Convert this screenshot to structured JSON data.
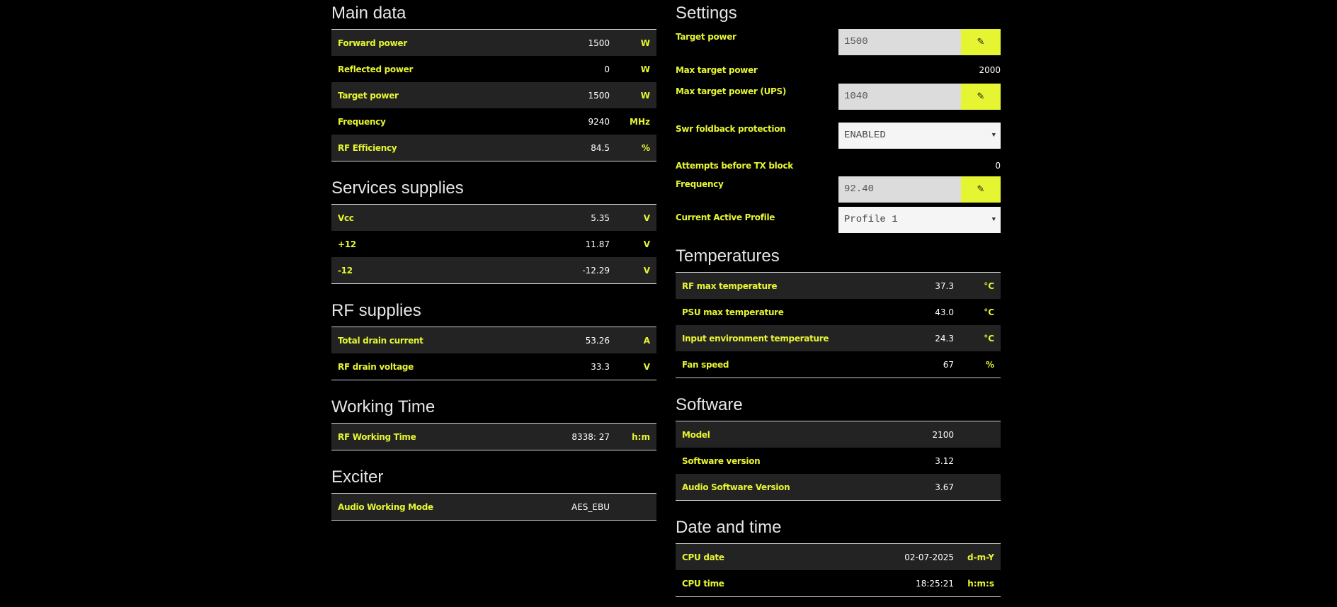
{
  "colors": {
    "accent": "#e6f532",
    "background": "#000000",
    "row_alt": "#232323"
  },
  "main_data": {
    "title": "Main data",
    "rows": [
      {
        "label": "Forward power",
        "value": "1500",
        "unit": "W"
      },
      {
        "label": "Reflected power",
        "value": "0",
        "unit": "W"
      },
      {
        "label": "Target power",
        "value": "1500",
        "unit": "W"
      },
      {
        "label": "Frequency",
        "value": "9240",
        "unit": "MHz"
      },
      {
        "label": "RF Efficiency",
        "value": "84.5",
        "unit": "%"
      }
    ]
  },
  "services_supplies": {
    "title": "Services supplies",
    "rows": [
      {
        "label": "Vcc",
        "value": "5.35",
        "unit": "V"
      },
      {
        "label": "+12",
        "value": "11.87",
        "unit": "V"
      },
      {
        "label": "-12",
        "value": "-12.29",
        "unit": "V"
      }
    ]
  },
  "rf_supplies": {
    "title": "RF supplies",
    "rows": [
      {
        "label": "Total drain current",
        "value": "53.26",
        "unit": "A"
      },
      {
        "label": "RF drain voltage",
        "value": "33.3",
        "unit": "V"
      }
    ]
  },
  "working_time": {
    "title": "Working Time",
    "rows": [
      {
        "label": "RF Working Time",
        "value": "8338: 27",
        "unit": "h:m"
      }
    ]
  },
  "exciter": {
    "title": "Exciter",
    "rows": [
      {
        "label": "Audio Working Mode",
        "value": "AES_EBU",
        "unit": ""
      }
    ]
  },
  "settings": {
    "title": "Settings",
    "target_power": {
      "label": "Target power",
      "value": "1500",
      "edit_icon": "pencil-icon"
    },
    "max_target_power": {
      "label": "Max target power",
      "value": "2000"
    },
    "max_target_power_ups": {
      "label": "Max target power (UPS)",
      "value": "1040",
      "edit_icon": "pencil-icon"
    },
    "swr_foldback": {
      "label": "Swr foldback protection",
      "selected": "ENABLED"
    },
    "attempts": {
      "label": "Attempts before TX block",
      "value": "0"
    },
    "frequency": {
      "label": "Frequency",
      "value": "92.40",
      "edit_icon": "pencil-icon"
    },
    "active_profile": {
      "label": "Current Active Profile",
      "selected": "Profile 1"
    }
  },
  "temperatures": {
    "title": "Temperatures",
    "rows": [
      {
        "label": "RF max temperature",
        "value": "37.3",
        "unit": "°C"
      },
      {
        "label": "PSU max temperature",
        "value": "43.0",
        "unit": "°C"
      },
      {
        "label": "Input environment temperature",
        "value": "24.3",
        "unit": "°C"
      },
      {
        "label": "Fan speed",
        "value": "67",
        "unit": "%"
      }
    ]
  },
  "software": {
    "title": "Software",
    "rows": [
      {
        "label": "Model",
        "value": "2100",
        "unit": ""
      },
      {
        "label": "Software version",
        "value": "3.12",
        "unit": ""
      },
      {
        "label": "Audio Software Version",
        "value": "3.67",
        "unit": ""
      }
    ]
  },
  "date_time": {
    "title": "Date and time",
    "rows": [
      {
        "label": "CPU date",
        "value": "02-07-2025",
        "unit": "d-m-Y"
      },
      {
        "label": "CPU time",
        "value": "18:25:21",
        "unit": "h:m:s"
      }
    ]
  }
}
